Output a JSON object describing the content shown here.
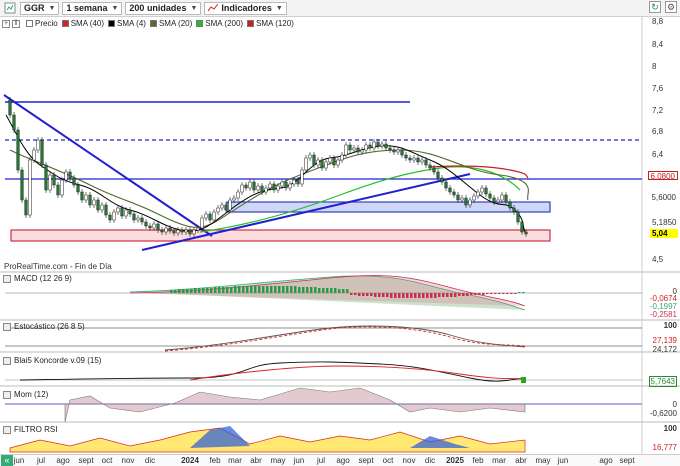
{
  "toolbar": {
    "ticker": "GGR",
    "period": "1 semana",
    "units": "200 unidades",
    "indicators": "Indicadores"
  },
  "legend": {
    "items": [
      {
        "label": "Precio",
        "color": "#ffffff"
      },
      {
        "label": "SMA (40)",
        "color": "#d62020"
      },
      {
        "label": "SMA (4)",
        "color": "#000000"
      },
      {
        "label": "SMA (20)",
        "color": "#556b2f"
      },
      {
        "label": "SMA (200)",
        "color": "#22c022"
      },
      {
        "label": "SMA (120)",
        "color": "#c42020"
      }
    ]
  },
  "watermark": "ProRealTime.com - Fin de Día",
  "price_axis": {
    "labels": [
      "8,8",
      "8,4",
      "8",
      "7,6",
      "7,2",
      "6,8",
      "6,4",
      "6",
      "5,6",
      "5,1850",
      "4,5"
    ],
    "tags": [
      {
        "text": "6,0800",
        "color": "#c42020",
        "bg": "#ffffff"
      },
      {
        "text": "5,6000",
        "color": "#333333",
        "bg": "#ffffff"
      },
      {
        "text": "5,04",
        "color": "#000000",
        "bg": "#ffff00"
      }
    ]
  },
  "panes": {
    "macd": {
      "label": "MACD (12 26 9)",
      "axis": [
        "0",
        "-0,0674",
        "-0,1997",
        "-0,2581"
      ]
    },
    "stoch": {
      "label": "Estocástico (26 8 5)",
      "axis": [
        "100",
        "27,139",
        "24,172"
      ]
    },
    "koncorde": {
      "label": "Blai5 Koncorde v.09 (15)",
      "axis": [
        "5,7643",
        "0"
      ]
    },
    "mom": {
      "label": "Mom (12)",
      "axis": [
        "0",
        "-0,6200"
      ]
    },
    "rsi": {
      "label": "FILTRO RSI",
      "axis": [
        "100",
        "16,777"
      ]
    }
  },
  "xaxis": {
    "labels": [
      {
        "text": "jun",
        "bold": false
      },
      {
        "text": "jul",
        "bold": false
      },
      {
        "text": "ago",
        "bold": false
      },
      {
        "text": "sept",
        "bold": false
      },
      {
        "text": "oct",
        "bold": false
      },
      {
        "text": "nov",
        "bold": false
      },
      {
        "text": "dic",
        "bold": false
      },
      {
        "text": "2024",
        "bold": true
      },
      {
        "text": "feb",
        "bold": false
      },
      {
        "text": "mar",
        "bold": false
      },
      {
        "text": "abr",
        "bold": false
      },
      {
        "text": "may",
        "bold": false
      },
      {
        "text": "jun",
        "bold": false
      },
      {
        "text": "jul",
        "bold": false
      },
      {
        "text": "ago",
        "bold": false
      },
      {
        "text": "sept",
        "bold": false
      },
      {
        "text": "oct",
        "bold": false
      },
      {
        "text": "nov",
        "bold": false
      },
      {
        "text": "dic",
        "bold": false
      },
      {
        "text": "2025",
        "bold": true
      },
      {
        "text": "feb",
        "bold": false
      },
      {
        "text": "mar",
        "bold": false
      },
      {
        "text": "abr",
        "bold": false
      },
      {
        "text": "may",
        "bold": false
      },
      {
        "text": "jun",
        "bold": false
      },
      {
        "text": "ago",
        "bold": false
      },
      {
        "text": "sept",
        "bold": false
      }
    ]
  },
  "colors": {
    "trend_blue": "#2020d0",
    "support_box": "#d03040",
    "resist_box": "#3040c0"
  }
}
